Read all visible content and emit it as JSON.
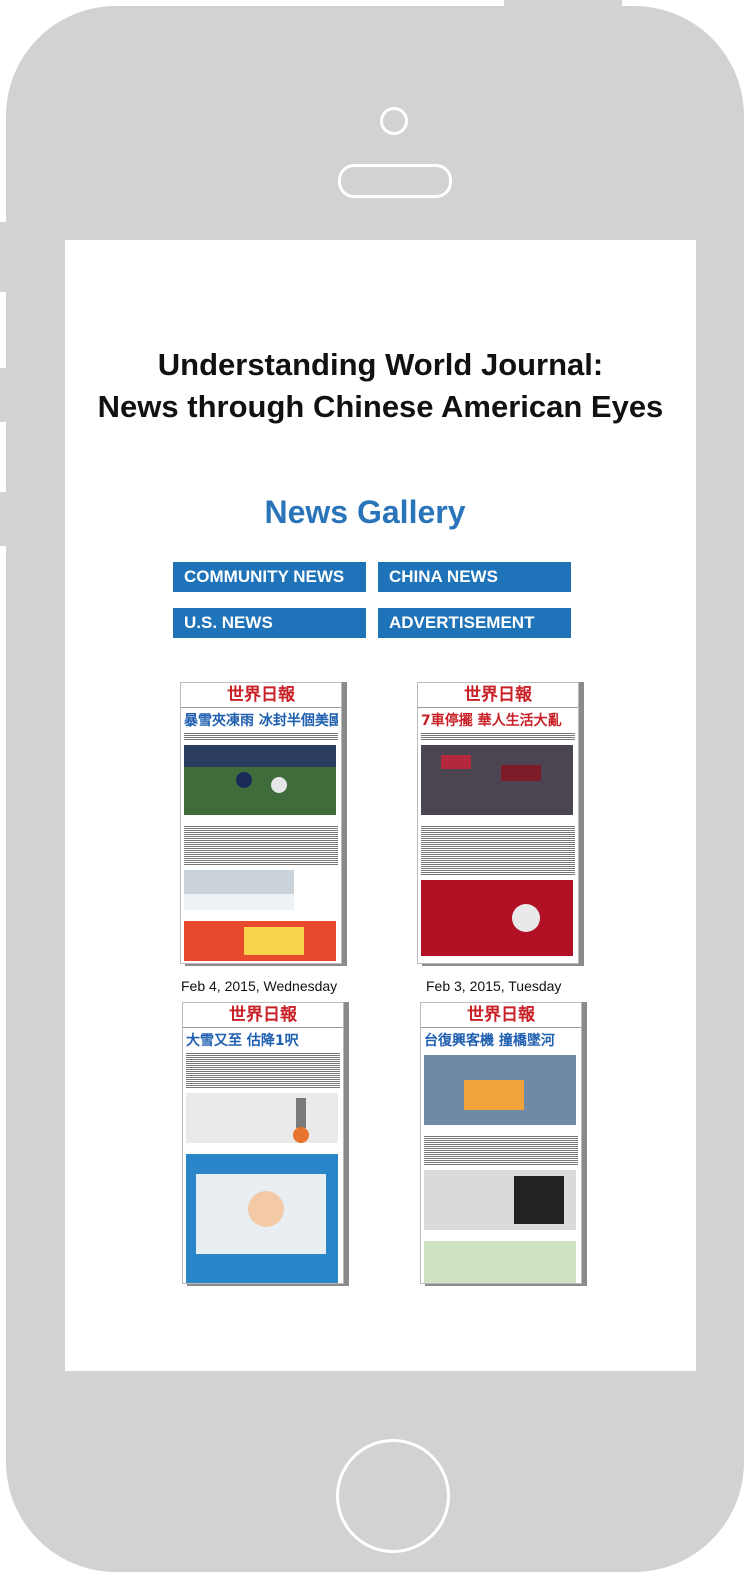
{
  "page": {
    "title_line1": "Understanding World Journal:",
    "title_line2": "News through Chinese American Eyes",
    "gallery_heading": "News Gallery"
  },
  "tabs": [
    {
      "label": "COMMUNITY NEWS"
    },
    {
      "label": "CHINA NEWS"
    },
    {
      "label": "U.S. NEWS"
    },
    {
      "label": "ADVERTISEMENT"
    }
  ],
  "gallery": [
    {
      "masthead": "世界日報",
      "headline": "暴雪夾凍雨 冰封半個美國",
      "caption": "Feb 4, 2015, Wednesday"
    },
    {
      "masthead": "世界日報",
      "headline": "7車停擺 華人生活大亂",
      "caption": "Feb 3, 2015, Tuesday"
    },
    {
      "masthead": "世界日報",
      "headline": "大雪又至 估降1呎",
      "caption": ""
    },
    {
      "masthead": "世界日報",
      "headline": "台復興客機 撞橋墜河",
      "caption": ""
    }
  ],
  "colors": {
    "phone": "#d1d2d4",
    "accent": "#1f73b8",
    "heading": "#2a74b9"
  }
}
